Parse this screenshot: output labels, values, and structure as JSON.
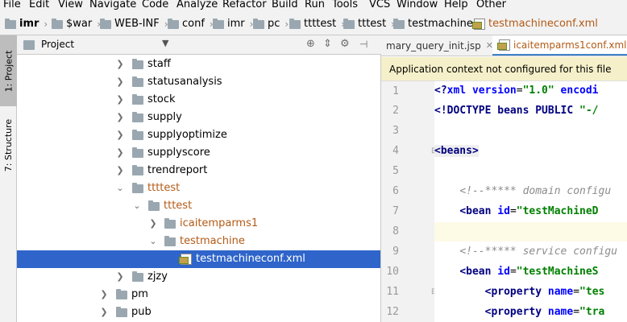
{
  "menu": [
    "File",
    "Edit",
    "View",
    "Navigate",
    "Code",
    "Analyze",
    "Refactor",
    "Build",
    "Run",
    "Tools",
    "VCS",
    "Window",
    "Help",
    "Other"
  ],
  "breadcrumb": [
    "imr",
    "$war",
    "WEB-INF",
    "conf",
    "imr",
    "pc",
    "ttttest",
    "tttest",
    "testmachine",
    "testmachineconf.xml"
  ],
  "sidebar": {
    "project_tab": "1: Project",
    "structure_tab": "7: Structure"
  },
  "project_panel": {
    "title": "Project",
    "tree": [
      {
        "label": "staff"
      },
      {
        "label": "statusanalysis"
      },
      {
        "label": "stock"
      },
      {
        "label": "supply"
      },
      {
        "label": "supplyoptimize"
      },
      {
        "label": "supplyscore"
      },
      {
        "label": "trendreport"
      },
      {
        "label": "ttttest"
      },
      {
        "label": "tttest"
      },
      {
        "label": "icaitemparms1"
      },
      {
        "label": "testmachine"
      },
      {
        "label": "testmachineconf.xml"
      },
      {
        "label": "zjzy"
      },
      {
        "label": "pm"
      },
      {
        "label": "pub"
      }
    ]
  },
  "editor": {
    "tabs": [
      "mary_query_init.jsp",
      "icaitemparms1conf.xml"
    ],
    "notice": "Application context not configured for this file",
    "line_numbers": [
      "1",
      "2",
      "3",
      "4",
      "5",
      "6",
      "7",
      "8",
      "9",
      "10",
      "11",
      "12"
    ]
  },
  "colors": {
    "selection": "#2f65ca",
    "accent": "#4083c9",
    "notice_bg": "#f5f0c9",
    "modified_folder": "#b35a16"
  }
}
